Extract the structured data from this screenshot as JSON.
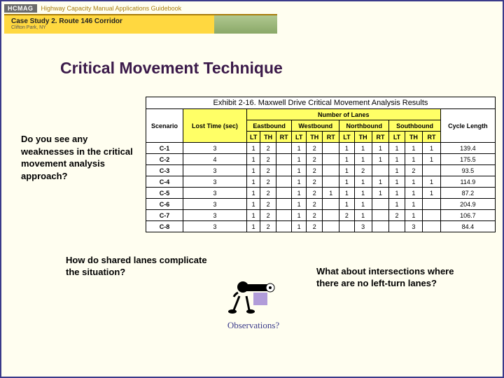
{
  "header": {
    "badge": "HCMAG",
    "subtitle": "Highway Capacity Manual Applications Guidebook",
    "case_title": "Case Study 2. Route 146 Corridor",
    "case_location": "Clifton Park, NY"
  },
  "title": "Critical Movement Technique",
  "question_left": "Do you see any weaknesses in the critical movement analysis approach?",
  "question_bottom_left": "How do shared lanes complicate the situation?",
  "question_bottom_right": "What about intersections where there are no left-turn lanes?",
  "observations_label": "Observations?",
  "table": {
    "title": "Exhibit 2-16. Maxwell Drive Critical Movement Analysis Results",
    "scenario_header": "Scenario",
    "lost_time_header": "Lost Time (sec)",
    "lanes_header": "Number of Lanes",
    "cycle_header": "Cycle Length",
    "dir_headers": [
      "Eastbound",
      "Westbound",
      "Northbound",
      "Southbound"
    ],
    "sub_headers": [
      "LT",
      "TH",
      "RT",
      "LT",
      "TH",
      "RT",
      "LT",
      "TH",
      "RT",
      "LT",
      "TH",
      "RT"
    ],
    "rows": [
      {
        "s": "C-1",
        "lt": "3",
        "v": [
          "1",
          "2",
          "",
          "1",
          "2",
          "",
          "1",
          "1",
          "1",
          "1",
          "1",
          "1"
        ],
        "cl": "139.4"
      },
      {
        "s": "C-2",
        "lt": "4",
        "v": [
          "1",
          "2",
          "",
          "1",
          "2",
          "",
          "1",
          "1",
          "1",
          "1",
          "1",
          "1"
        ],
        "cl": "175.5"
      },
      {
        "s": "C-3",
        "lt": "3",
        "v": [
          "1",
          "2",
          "",
          "1",
          "2",
          "",
          "1",
          "2",
          "",
          "1",
          "2",
          ""
        ],
        "cl": "93.5"
      },
      {
        "s": "C-4",
        "lt": "3",
        "v": [
          "1",
          "2",
          "",
          "1",
          "2",
          "",
          "1",
          "1",
          "1",
          "1",
          "1",
          "1"
        ],
        "cl": "114.9"
      },
      {
        "s": "C-5",
        "lt": "3",
        "v": [
          "1",
          "2",
          "",
          "1",
          "2",
          "1",
          "1",
          "1",
          "1",
          "1",
          "1",
          "1"
        ],
        "cl": "87.2"
      },
      {
        "s": "C-6",
        "lt": "3",
        "v": [
          "1",
          "2",
          "",
          "1",
          "2",
          "",
          "1",
          "1",
          "",
          "1",
          "1",
          ""
        ],
        "cl": "204.9"
      },
      {
        "s": "C-7",
        "lt": "3",
        "v": [
          "1",
          "2",
          "",
          "1",
          "2",
          "",
          "2",
          "1",
          "",
          "2",
          "1",
          ""
        ],
        "cl": "106.7"
      },
      {
        "s": "C-8",
        "lt": "3",
        "v": [
          "1",
          "2",
          "",
          "1",
          "2",
          "",
          "",
          "3",
          "",
          "",
          "3",
          ""
        ],
        "cl": "84.4"
      }
    ]
  }
}
